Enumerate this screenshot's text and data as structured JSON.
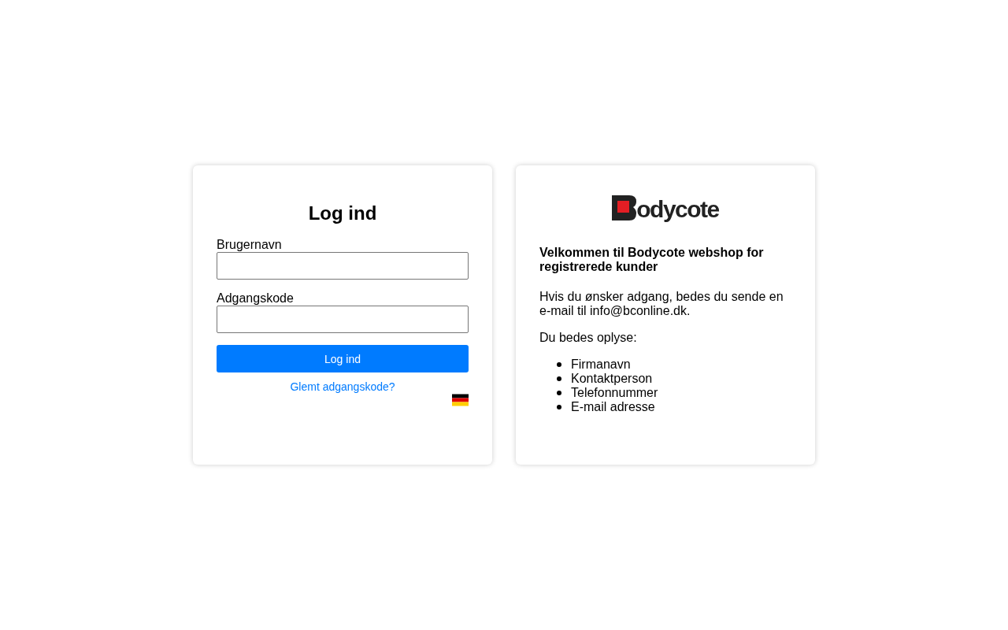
{
  "login": {
    "title": "Log ind",
    "fields": [
      {
        "label": "Brugernavn"
      },
      {
        "label": "Adgangskode"
      }
    ],
    "submit": "Log ind",
    "forgot": "Glemt adgangskode?"
  },
  "info": {
    "logo": "odycote",
    "heading": "Velkommen til Bodycote webshop for registrerede kunder",
    "paragraphs": [
      "Hvis du ønsker adgang, bedes du sende en e-mail til info@bconline.dk.",
      "Du bedes oplyse:"
    ],
    "items": [
      "Firmanavn",
      "Kontaktperson",
      "Telefonnummer",
      "E-mail adresse"
    ]
  }
}
